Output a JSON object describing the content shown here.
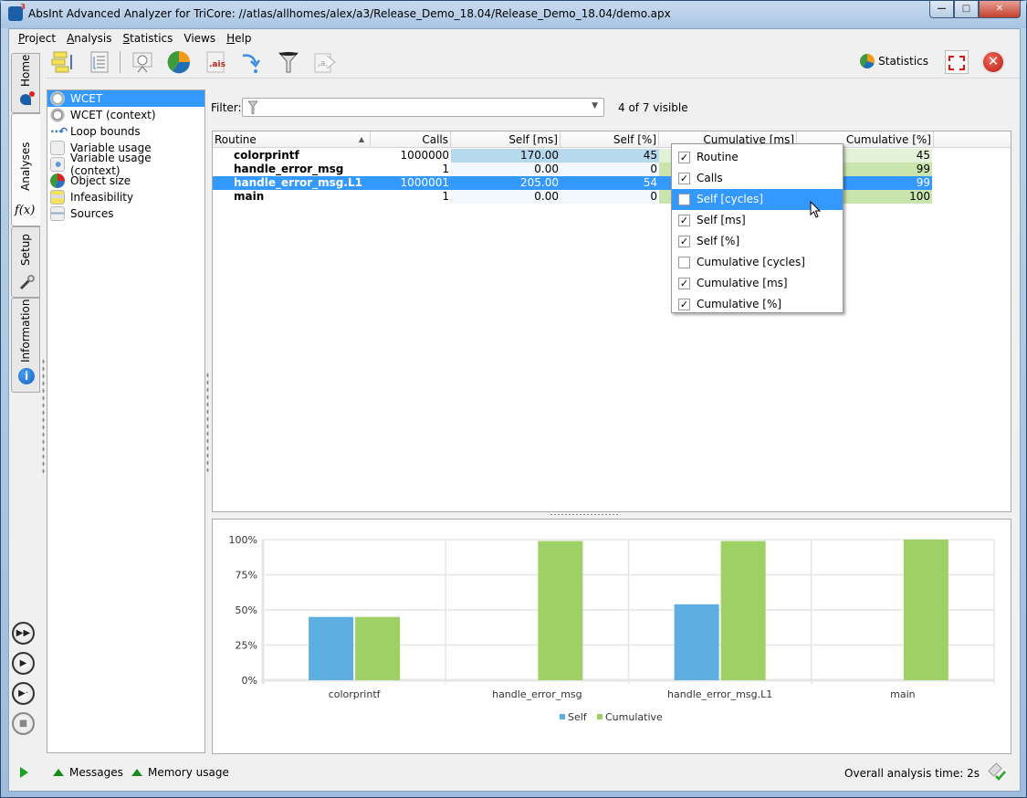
{
  "window": {
    "title": "AbsInt Advanced Analyzer for TriCore: //atlas/allhomes/alex/a3/Release_Demo_18.04/Release_Demo_18.04/demo.apx",
    "minimize": "—",
    "maximize": "□",
    "close": "✕"
  },
  "menubar": {
    "items": [
      {
        "label": "Project",
        "mnemonic": "P",
        "rest": "roject"
      },
      {
        "label": "Analysis",
        "mnemonic": "A",
        "rest": "nalysis"
      },
      {
        "label": "Statistics",
        "mnemonic": "S",
        "rest": "tatistics"
      },
      {
        "label": "Views",
        "mnemonic": "",
        "rest": "Views"
      },
      {
        "label": "Help",
        "mnemonic": "H",
        "rest": "elp"
      }
    ]
  },
  "toolbar": {
    "icons": [
      "call-graph-icon",
      "report-list-icon",
      "wcet-stopwatch-icon",
      "pie-chart-icon",
      "ais-file-icon",
      "step-into-arrow-icon",
      "filter-funnel-icon",
      "annotation-export-icon"
    ],
    "statistics_label": "Statistics",
    "statistics_icon": "pie-chart-icon",
    "maximize_view_icon": "maximize-view-icon",
    "close_view_icon": "close-view-icon"
  },
  "left_tabs": [
    {
      "label": "Home",
      "icon": "a3-logo-icon"
    },
    {
      "label": "Analyses",
      "icon": "function-fx-icon",
      "icon_text": "f(x)",
      "active": true
    },
    {
      "label": "Setup",
      "icon": "wrench-icon"
    },
    {
      "label": "Information",
      "icon": "info-icon",
      "icon_text": "i"
    }
  ],
  "run_controls": [
    {
      "name": "run-all-button",
      "glyph": "▶▶"
    },
    {
      "name": "run-button",
      "glyph": "▶"
    },
    {
      "name": "run-step-button",
      "glyph": "▶·"
    },
    {
      "name": "stop-button",
      "glyph": "■",
      "disabled": true
    }
  ],
  "nav": {
    "items": [
      {
        "label": "WCET",
        "icon": "stopwatch-icon",
        "selected": true
      },
      {
        "label": "WCET (context)",
        "icon": "stopwatch-context-icon"
      },
      {
        "label": "Loop bounds",
        "icon": "loop-arrow-icon"
      },
      {
        "label": "Variable usage",
        "icon": "variable-usage-icon"
      },
      {
        "label": "Variable usage (context)",
        "icon": "variable-search-icon"
      },
      {
        "label": "Object size",
        "icon": "object-size-pie-icon"
      },
      {
        "label": "Infeasibility",
        "icon": "infeasibility-icon"
      },
      {
        "label": "Sources",
        "icon": "sources-icon"
      }
    ]
  },
  "filter": {
    "label": "Filter:",
    "value": "",
    "placeholder": "",
    "visible_count": "4 of 7 visible"
  },
  "table": {
    "columns": [
      "Routine",
      "Calls",
      "Self [ms]",
      "Self [%]",
      "Cumulative [ms]",
      "Cumulative [%]"
    ],
    "sorted_column": "Routine",
    "rows": [
      {
        "routine": "colorprintf",
        "calls": "1000000",
        "self_ms": "170.00",
        "self_pct": "45",
        "cum_pct": "45",
        "selected": false
      },
      {
        "routine": "handle_error_msg",
        "calls": "1",
        "self_ms": "0.00",
        "self_pct": "0",
        "cum_pct": "99",
        "selected": false
      },
      {
        "routine": "handle_error_msg.L1",
        "calls": "1000001",
        "self_ms": "205.00",
        "self_pct": "54",
        "cum_pct": "99",
        "selected": true
      },
      {
        "routine": "main",
        "calls": "1",
        "self_ms": "0.00",
        "self_pct": "0",
        "cum_pct": "100",
        "selected": false
      }
    ]
  },
  "column_menu": {
    "items": [
      {
        "label": "Routine",
        "checked": true
      },
      {
        "label": "Calls",
        "checked": true
      },
      {
        "label": "Self [cycles]",
        "checked": false,
        "hover": true
      },
      {
        "label": "Self [ms]",
        "checked": true
      },
      {
        "label": "Self [%]",
        "checked": true
      },
      {
        "label": "Cumulative [cycles]",
        "checked": false
      },
      {
        "label": "Cumulative [ms]",
        "checked": true
      },
      {
        "label": "Cumulative [%]",
        "checked": true
      }
    ],
    "check_glyph": "✓"
  },
  "colors": {
    "selection": "#3399ff",
    "self_bar": "#5dade0",
    "cumulative_bar": "#9ed065",
    "self_cell_bg": "#b7d9ee",
    "self_cell_light": "#f2f8fc",
    "cum_cell_bg": "#c9e4ac",
    "cum_cell_light": "#e3f1d6"
  },
  "chart_data": {
    "type": "bar",
    "title": "",
    "xlabel": "",
    "ylabel": "",
    "categories": [
      "colorprintf",
      "handle_error_msg",
      "handle_error_msg.L1",
      "main"
    ],
    "series": [
      {
        "name": "Self",
        "values": [
          45,
          0,
          54,
          0
        ],
        "color": "#5dade0"
      },
      {
        "name": "Cumulative",
        "values": [
          45,
          99,
          99,
          100
        ],
        "color": "#9ed065"
      }
    ],
    "ylim": [
      0,
      100
    ],
    "yticks": [
      "0%",
      "25%",
      "50%",
      "75%",
      "100%"
    ],
    "ytick_values": [
      0,
      25,
      50,
      75,
      100
    ],
    "grid": true,
    "legend_position": "bottom-center"
  },
  "statusbar": {
    "messages_label": "Messages",
    "memory_label": "Memory usage",
    "analysis_time": "Overall analysis time: 2s"
  }
}
